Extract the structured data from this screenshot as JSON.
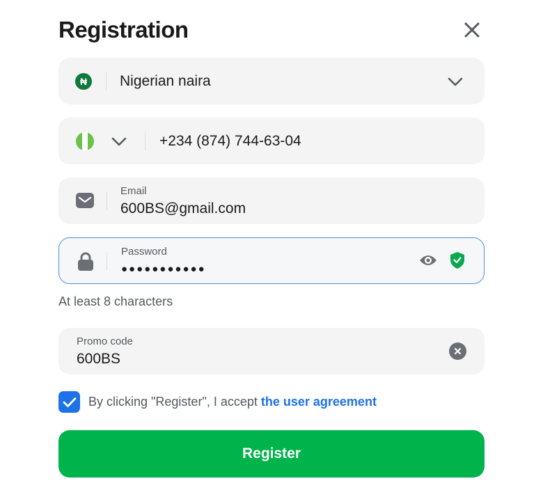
{
  "title": "Registration",
  "currency": {
    "symbol": "₦",
    "value": "Nigerian naira"
  },
  "phone": {
    "value": "+234 (874) 744-63-04"
  },
  "email": {
    "label": "Email",
    "value": "600BS@gmail.com"
  },
  "password": {
    "label": "Password",
    "value": "●●●●●●●●●●●",
    "hint": "At least 8 characters"
  },
  "promo": {
    "label": "Promo code",
    "value": "600BS"
  },
  "agreement": {
    "checked": true,
    "text": "By clicking \"Register\", I accept ",
    "link": "the user agreement"
  },
  "register_label": "Register",
  "colors": {
    "accent_blue": "#1d72e8",
    "register_green": "#00b34a",
    "flag_green": "#6cc24a",
    "shield_green": "#0aa84f"
  },
  "icons": [
    "close-icon",
    "naira-icon",
    "chevron-down-icon",
    "nigeria-flag-icon",
    "mail-icon",
    "lock-icon",
    "eye-icon",
    "shield-check-icon",
    "clear-icon",
    "check-icon"
  ]
}
